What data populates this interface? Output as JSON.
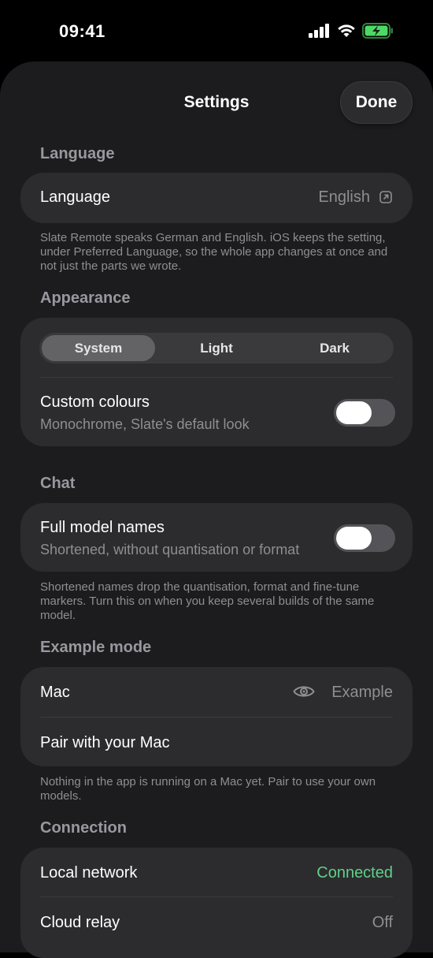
{
  "status_bar": {
    "time": "09:41",
    "icons": [
      "signal-icon",
      "wifi-icon",
      "battery-charging-icon"
    ],
    "battery_color": "#4cd964"
  },
  "header": {
    "title": "Settings",
    "done_label": "Done"
  },
  "sections": {
    "language": {
      "header": "Language",
      "row_label": "Language",
      "row_value": "English",
      "row_icon": "external-link-icon",
      "footnote": "Slate Remote speaks German and English. iOS keeps the setting, under Preferred Language, so the whole app changes at once and not just the parts we wrote."
    },
    "appearance": {
      "header": "Appearance",
      "segments": [
        "System",
        "Light",
        "Dark"
      ],
      "selected_segment": "System",
      "custom_colours_label": "Custom colours",
      "custom_colours_sub": "Monochrome, Slate's default look",
      "custom_colours_on": false
    },
    "chat": {
      "header": "Chat",
      "full_names_label": "Full model names",
      "full_names_sub": "Shortened, without quantisation or format",
      "full_names_on": false,
      "footnote": "Shortened names drop the quantisation, format and fine-tune markers. Turn this on when you keep several builds of the same model."
    },
    "example_mode": {
      "header": "Example mode",
      "mac_label": "Mac",
      "mac_icon": "eye-icon",
      "mac_value": "Example",
      "pair_label": "Pair with your Mac",
      "footnote": "Nothing in the app is running on a Mac yet. Pair to use your own models."
    },
    "connection": {
      "header": "Connection",
      "local_label": "Local network",
      "local_value": "Connected",
      "local_value_color": "#5fd08a",
      "relay_label": "Cloud relay",
      "relay_value": "Off"
    }
  }
}
